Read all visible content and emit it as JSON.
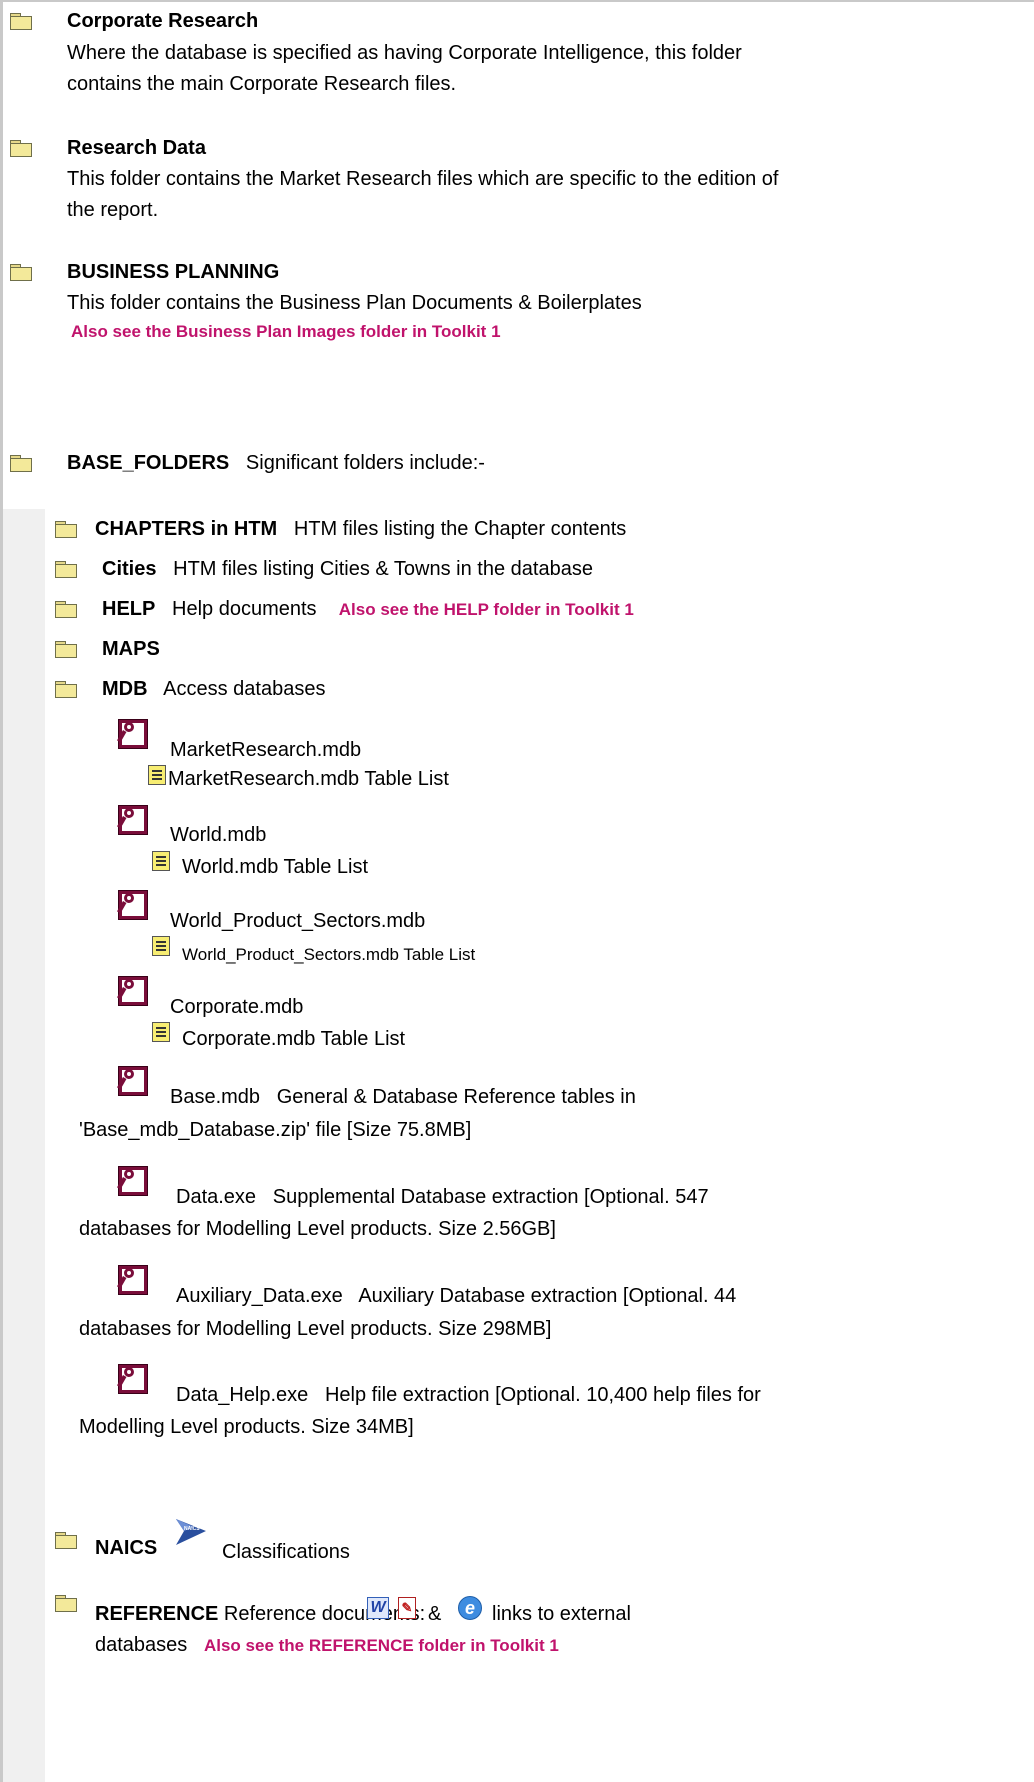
{
  "sections": [
    {
      "title": "Corporate Research",
      "description_line1": "Where the database is specified as having Corporate Intelligence, this folder",
      "description_line2": "contains the main Corporate Research files."
    },
    {
      "title": "Research Data",
      "description_line1": "This folder contains the Market Research files which are specific to the edition of",
      "description_line2": "the report."
    },
    {
      "title": "BUSINESS PLANNING",
      "description_line1": "This folder contains the Business Plan Documents & Boilerplates",
      "note": "Also see the Business Plan Images folder in Toolkit 1"
    },
    {
      "title": "BASE_FOLDERS",
      "description": "Significant folders include:-"
    }
  ],
  "subfolders": [
    {
      "name": "CHAPTERS in HTM",
      "description": "HTM files listing the Chapter contents"
    },
    {
      "name": "Cities",
      "description": "HTM files listing Cities & Towns in the database"
    },
    {
      "name": "HELP",
      "description": "Help documents",
      "note": "Also see the HELP folder in Toolkit 1"
    },
    {
      "name": "MAPS"
    },
    {
      "name": "MDB",
      "description": "Access databases"
    }
  ],
  "databases": [
    {
      "name": "MarketResearch.mdb",
      "table_list": "MarketResearch.mdb Table List"
    },
    {
      "name": "World.mdb",
      "table_list": "World.mdb Table List"
    },
    {
      "name": "World_Product_Sectors.mdb",
      "table_list": "World_Product_Sectors.mdb Table List"
    },
    {
      "name": "Corporate.mdb",
      "table_list": "Corporate.mdb Table List"
    }
  ],
  "extracts": [
    {
      "name": "Base.mdb",
      "line1": "General & Database Reference tables in",
      "line2": "'Base_mdb_Database.zip' file [Size 75.8MB]"
    },
    {
      "name": "Data.exe",
      "line1": "Supplemental Database extraction [Optional. 547",
      "line2": "databases for Modelling Level products. Size 2.56GB]"
    },
    {
      "name": "Auxiliary_Data.exe",
      "line1": "Auxiliary Database extraction [Optional. 44",
      "line2": "databases for Modelling Level products. Size 298MB]"
    },
    {
      "name": "Data_Help.exe",
      "line1": "Help file extraction [Optional. 10,400 help files for",
      "line2": "Modelling Level products. Size 34MB]"
    }
  ],
  "naics": {
    "name": "NAICS",
    "description": "Classifications",
    "logo_text": "NAICS"
  },
  "reference": {
    "name": "REFERENCE",
    "description": "Reference documents:",
    "ampersand": "&",
    "links_text": "links to external",
    "line2": "databases",
    "note": "Also see the REFERENCE folder in Toolkit 1"
  },
  "icons": {
    "folder": "folder-icon",
    "database": "access-key-icon",
    "document": "document-icon",
    "word": "word-icon",
    "pdf": "pdf-icon",
    "ie": "internet-explorer-icon"
  },
  "colors": {
    "note": "#c0136c",
    "folder": "#f3e99a",
    "access": "#7a0d3a",
    "band": "#f0f0f0"
  }
}
